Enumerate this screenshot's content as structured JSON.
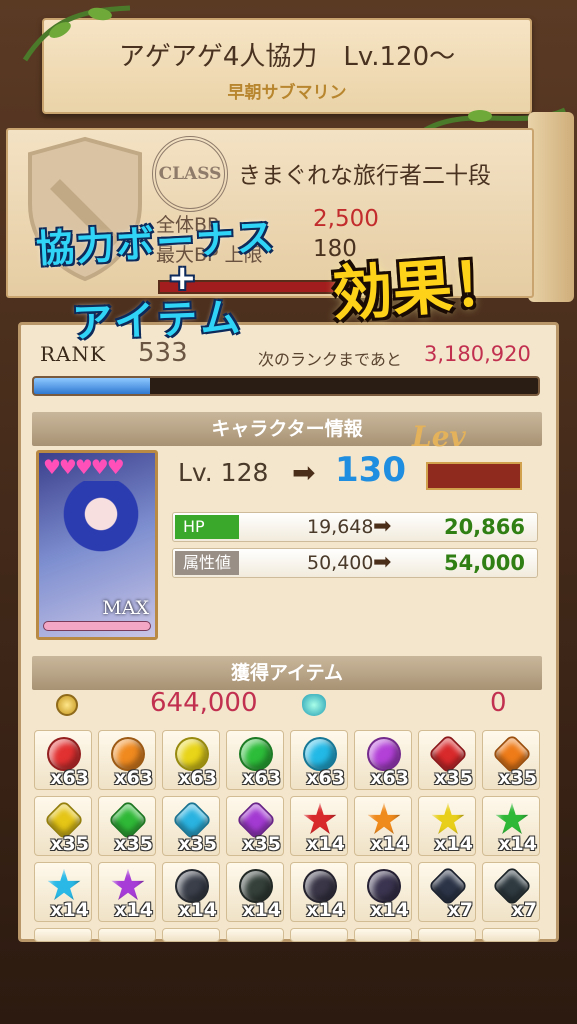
{
  "stage": {
    "title": "アゲアゲ4人協力　Lv.120～",
    "subtitle": "早朝サブマリン"
  },
  "class_panel": {
    "badge": "CLASS",
    "name": "きまぐれな旅行者二十段",
    "bp_label": "全体BP",
    "bp_value": "2,500",
    "bp2_label": "最大BP 上限",
    "bp2_value": "180"
  },
  "promo": {
    "line1": "協力ボーナス",
    "plus": "+",
    "line2": "アイテム",
    "line3": "効果！"
  },
  "rank": {
    "label": "RANK",
    "value": "533",
    "next_label": "次のランクまであと",
    "next_value": "3,180,920",
    "progress": 0.23
  },
  "character": {
    "section_title": "キャラクター情報",
    "hearts": "♥♥♥♥♥",
    "max_label": "MAX",
    "level_old": "Lv. 128",
    "level_new": "130",
    "lev_badge": "Lev",
    "stats": [
      {
        "label": "HP",
        "old": "19,648",
        "new": "20,866",
        "color": "#3aa82a"
      },
      {
        "label": "属性値",
        "old": "50,400",
        "new": "54,000",
        "color": "#9a8f86"
      }
    ]
  },
  "items": {
    "section_title": "獲得アイテム",
    "coin_value": "644,000",
    "soul_value": "0",
    "grid": [
      {
        "shape": "round",
        "color": "#e23131",
        "count": "x63"
      },
      {
        "shape": "round",
        "color": "#f08a1f",
        "count": "x63"
      },
      {
        "shape": "round",
        "color": "#e8d418",
        "count": "x63"
      },
      {
        "shape": "round",
        "color": "#2dbd3a",
        "count": "x63"
      },
      {
        "shape": "round",
        "color": "#23b9e6",
        "count": "x63"
      },
      {
        "shape": "round",
        "color": "#b341d8",
        "count": "x63"
      },
      {
        "shape": "hex",
        "color": "#d8292b",
        "count": "x35"
      },
      {
        "shape": "hex",
        "color": "#ee7b18",
        "count": "x35"
      },
      {
        "shape": "hex",
        "color": "#e5c516",
        "count": "x35"
      },
      {
        "shape": "hex",
        "color": "#2fb837",
        "count": "x35"
      },
      {
        "shape": "hex",
        "color": "#2ab3e0",
        "count": "x35"
      },
      {
        "shape": "hex",
        "color": "#a33ad2",
        "count": "x35"
      },
      {
        "shape": "star",
        "color": "#d8292b",
        "count": "x14"
      },
      {
        "shape": "star",
        "color": "#ef8a1c",
        "count": "x14"
      },
      {
        "shape": "star",
        "color": "#e8cf1a",
        "count": "x14"
      },
      {
        "shape": "star",
        "color": "#2fb837",
        "count": "x14"
      },
      {
        "shape": "star",
        "color": "#2ab9e6",
        "count": "x14"
      },
      {
        "shape": "star",
        "color": "#a73dd6",
        "count": "x14"
      },
      {
        "shape": "round",
        "color": "#3a3f4a",
        "count": "x14"
      },
      {
        "shape": "round",
        "color": "#35403a",
        "count": "x14"
      },
      {
        "shape": "round",
        "color": "#3a3648",
        "count": "x14"
      },
      {
        "shape": "round",
        "color": "#3b3450",
        "count": "x14"
      },
      {
        "shape": "hex",
        "color": "#2c3548",
        "count": "x7"
      },
      {
        "shape": "hex",
        "color": "#2e3a40",
        "count": "x7"
      }
    ]
  }
}
